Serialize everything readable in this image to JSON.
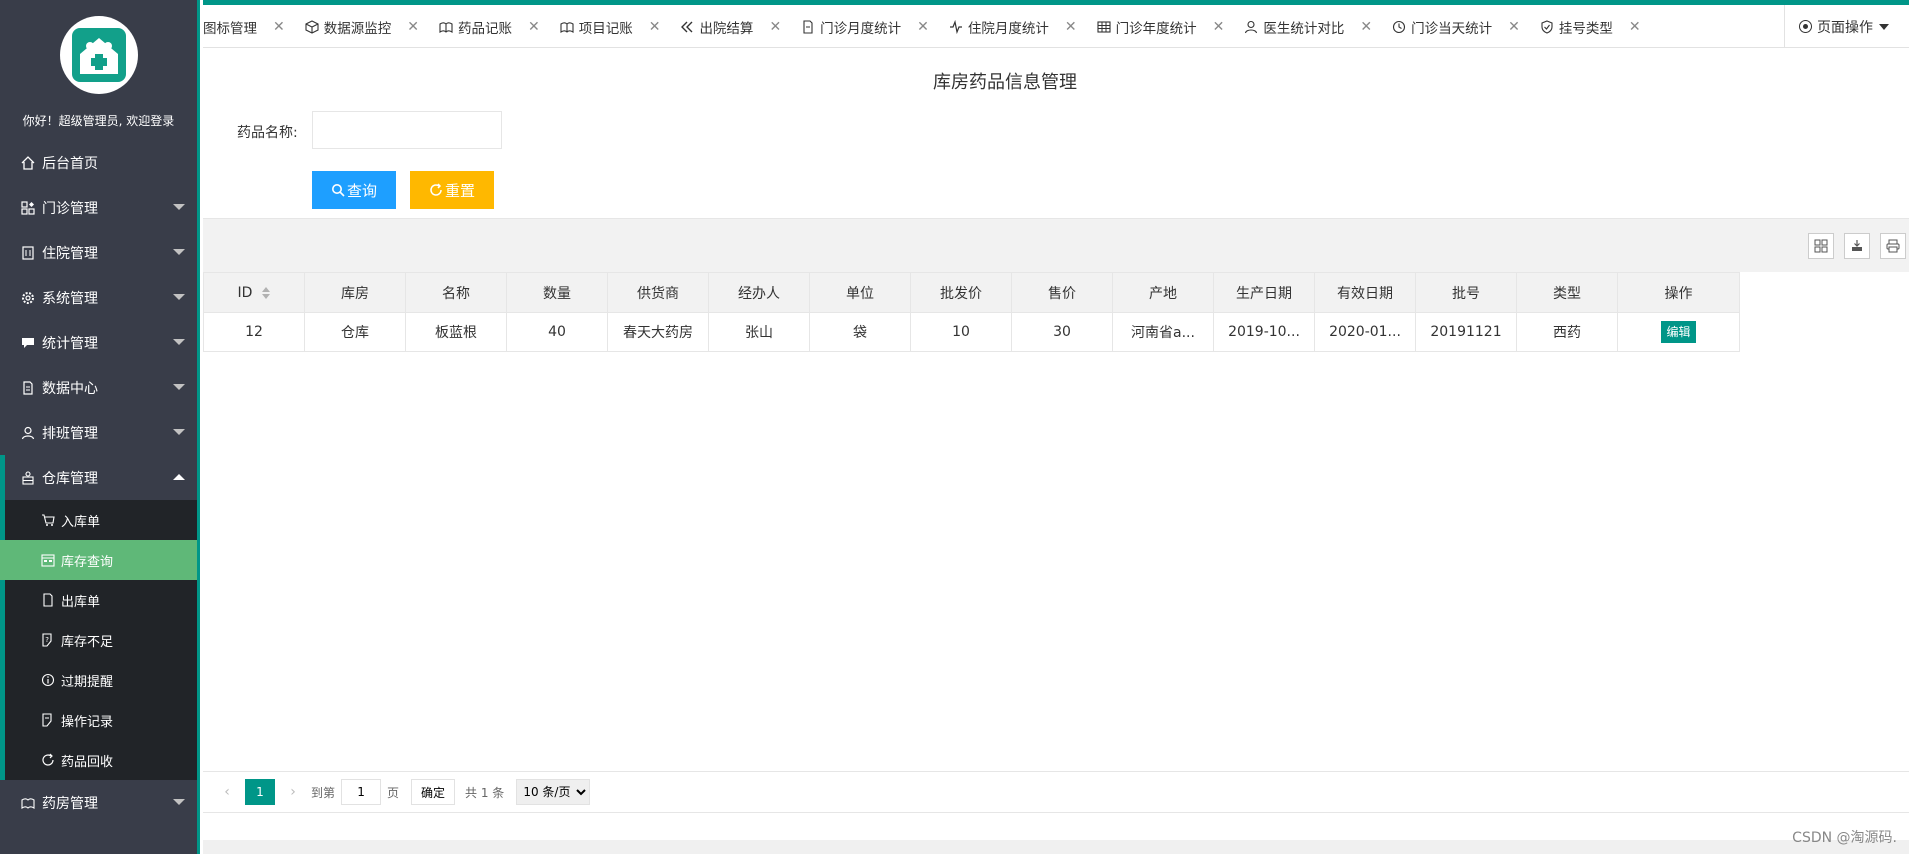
{
  "sidebar": {
    "welcome": "你好！超级管理员, 欢迎登录",
    "items": [
      {
        "label": "后台首页",
        "icon": "home-icon"
      },
      {
        "label": "门诊管理",
        "icon": "grid-icon"
      },
      {
        "label": "住院管理",
        "icon": "building-icon"
      },
      {
        "label": "系统管理",
        "icon": "gear-icon"
      },
      {
        "label": "统计管理",
        "icon": "chat-icon"
      },
      {
        "label": "数据中心",
        "icon": "document-icon"
      },
      {
        "label": "排班管理",
        "icon": "user-icon"
      },
      {
        "label": "仓库管理",
        "icon": "warehouse-icon"
      },
      {
        "label": "药房管理",
        "icon": "pharmacy-icon"
      }
    ],
    "sub_items": [
      {
        "label": "入库单",
        "icon": "cart-icon"
      },
      {
        "label": "库存查询",
        "icon": "calendar-icon"
      },
      {
        "label": "出库单",
        "icon": "file-icon"
      },
      {
        "label": "库存不足",
        "icon": "note-icon"
      },
      {
        "label": "过期提醒",
        "icon": "info-icon"
      },
      {
        "label": "操作记录",
        "icon": "edit-note-icon"
      },
      {
        "label": "药品回收",
        "icon": "refresh-icon"
      }
    ]
  },
  "tabs": [
    {
      "label": "图标管理",
      "icon": ""
    },
    {
      "label": "数据源监控",
      "icon": "cube-icon"
    },
    {
      "label": "药品记账",
      "icon": "book-icon"
    },
    {
      "label": "项目记账",
      "icon": "book-icon"
    },
    {
      "label": "出院结算",
      "icon": "double-left-icon"
    },
    {
      "label": "门诊月度统计",
      "icon": "file-icon"
    },
    {
      "label": "住院月度统计",
      "icon": "pulse-icon"
    },
    {
      "label": "门诊年度统计",
      "icon": "table-icon"
    },
    {
      "label": "医生统计对比",
      "icon": "user-icon"
    },
    {
      "label": "门诊当天统计",
      "icon": "clock-icon"
    },
    {
      "label": "挂号类型",
      "icon": "shield-icon"
    }
  ],
  "page_ops": "页面操作",
  "page": {
    "title": "库房药品信息管理",
    "search_label": "药品名称:",
    "search_value": "",
    "query_btn": "查询",
    "reset_btn": "重置"
  },
  "table": {
    "columns": [
      "ID",
      "库房",
      "名称",
      "数量",
      "供货商",
      "经办人",
      "单位",
      "批发价",
      "售价",
      "产地",
      "生产日期",
      "有效日期",
      "批号",
      "类型",
      "操作"
    ],
    "rows": [
      [
        "12",
        "仓库",
        "板蓝根",
        "40",
        "春天大药房",
        "张山",
        "袋",
        "10",
        "30",
        "河南省a...",
        "2019-10...",
        "2020-01...",
        "20191121",
        "西药",
        "编辑"
      ]
    ]
  },
  "pager": {
    "current": "1",
    "goto_label": "到第",
    "goto_value": "1",
    "page_unit": "页",
    "confirm": "确定",
    "total": "共 1 条",
    "page_size": "10 条/页"
  },
  "watermark": "CSDN @淘源码.",
  "colors": {
    "theme": "#009688",
    "sidebar": "#393d49",
    "active": "#5fb878",
    "query": "#1e9fff",
    "reset": "#ffb800"
  }
}
